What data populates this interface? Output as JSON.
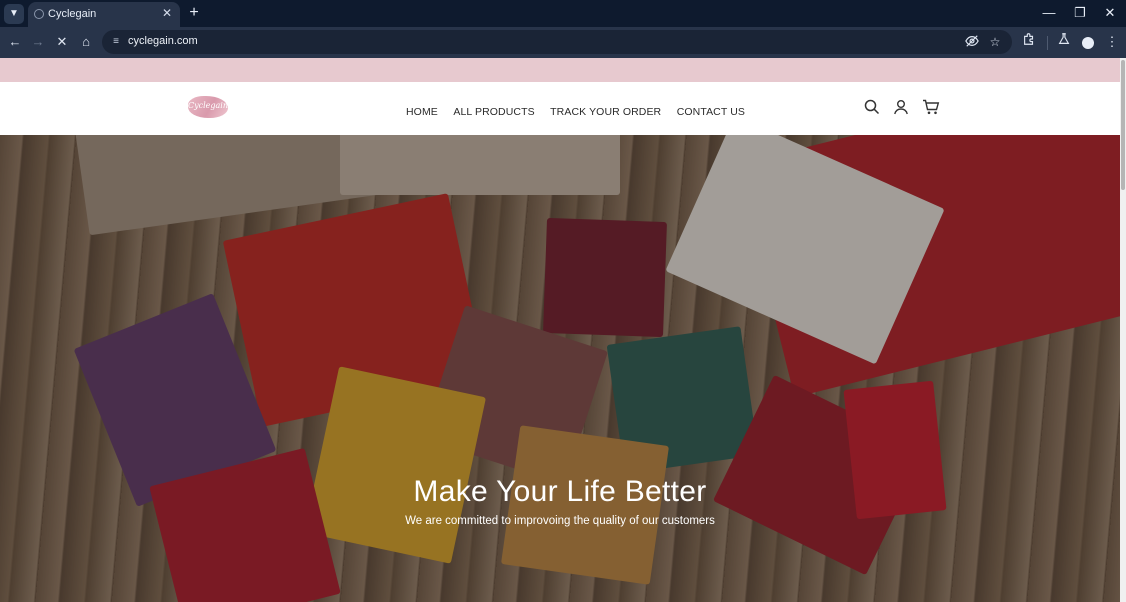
{
  "browser": {
    "tab_title": "Cyclegain",
    "url": "cyclegain.com",
    "icons": {
      "tab_search": "chevron-down-icon",
      "new_tab": "plus-icon",
      "back": "arrow-left-icon",
      "forward": "arrow-right-icon",
      "stop": "close-icon",
      "home": "home-icon",
      "site_info": "tune-icon",
      "eye_off": "eye-off-icon",
      "bookmark": "star-icon",
      "extensions": "puzzle-icon",
      "labs": "flask-icon",
      "profile": "profile-icon",
      "menu": "more-vertical-icon"
    }
  },
  "site": {
    "logo_text": "Cyclegain",
    "nav": [
      "HOME",
      "ALL PRODUCTS",
      "TRACK YOUR ORDER",
      "CONTACT US"
    ],
    "icons": [
      "search-icon",
      "account-icon",
      "cart-icon"
    ]
  },
  "hero": {
    "title": "Make Your Life Better",
    "subtitle": "We are committed to improvoing the quality of our customers"
  },
  "colors": {
    "announcement_bar": "#e7c9cf",
    "browser_frame": "#0e1a2e",
    "browser_toolbar": "#28344a"
  }
}
